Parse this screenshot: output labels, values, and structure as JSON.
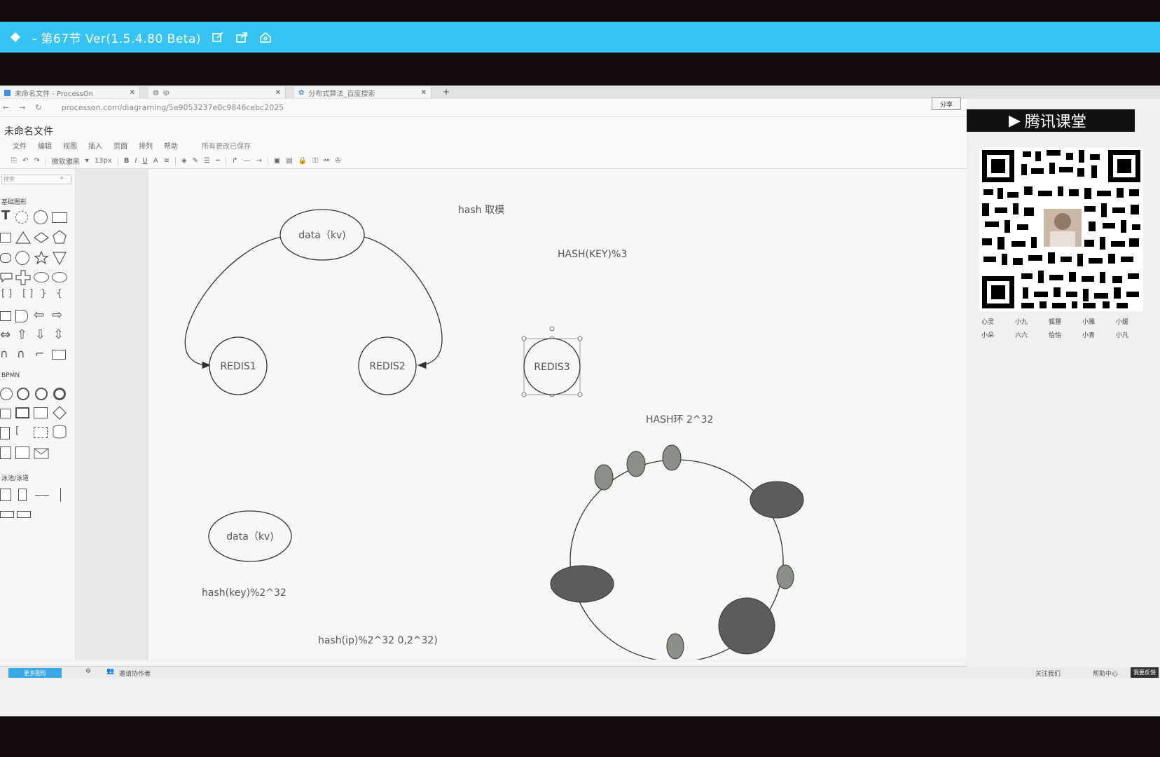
{
  "player": {
    "title": "- 第67节 Ver(1.5.4.80 Beta)"
  },
  "browser": {
    "tabs": [
      {
        "label": "未命名文件 - ProcessOn"
      },
      {
        "label": "ip"
      },
      {
        "label": "分布式算法_百度搜索"
      }
    ],
    "url": "processon.com/diagraming/5e9053237e0c9846cebc2025",
    "share_label": "分享"
  },
  "app": {
    "doc_title": "未命名文件",
    "menu": [
      "文件",
      "编辑",
      "视图",
      "插入",
      "页面",
      "排列",
      "帮助",
      "所有更改已保存"
    ],
    "toolbar": {
      "font": "微软雅黑",
      "size": "13px",
      "bold": "B",
      "italic": "I",
      "underline": "U",
      "color": "A"
    },
    "left_panel": {
      "search_placeholder": "搜索",
      "sections": [
        "基础图形",
        "BPMN",
        "泳池/泳道"
      ]
    },
    "status": {
      "left_button": "更多图形",
      "invite": "邀请协作者",
      "follow": "关注我们",
      "help": "帮助中心",
      "feedback": "我要反馈"
    }
  },
  "diagram": {
    "hash_mod_label": "hash 取模",
    "hash_key_mod3": "HASH(KEY)%3",
    "data_kv_top": "data（kv)",
    "redis1": "REDIS1",
    "redis2": "REDIS2",
    "redis3": "REDIS3",
    "hash_ring_label": "HASH环 2^32",
    "data_kv_bottom": "data（kv)",
    "hash_key_mod232": "hash(key)%2^32",
    "hash_ip_mod232": "hash(ip)%2^32  0,2^32)"
  },
  "sidebar": {
    "brand": "腾讯课堂",
    "names": [
      "心灵",
      "小九",
      "狐狸",
      "小雅",
      "小媛",
      "小朵",
      "六六",
      "怡怡",
      "小青",
      "小凡"
    ]
  }
}
